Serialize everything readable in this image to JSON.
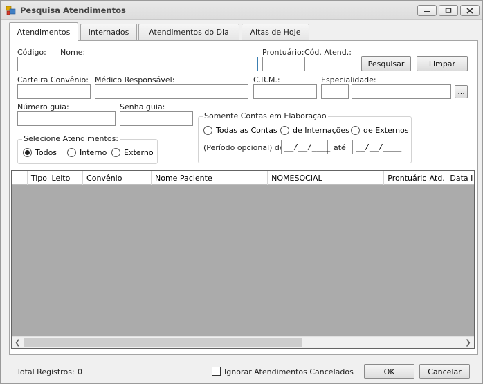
{
  "window": {
    "title": "Pesquisa Atendimentos"
  },
  "tabs": [
    {
      "label": "Atendimentos"
    },
    {
      "label": "Internados"
    },
    {
      "label": "Atendimentos do Dia"
    },
    {
      "label": "Altas de Hoje"
    }
  ],
  "form": {
    "codigo_label": "Código:",
    "nome_label": "Nome:",
    "prontuario_label": "Prontuário:",
    "cod_atend_label": "Cód. Atend.:",
    "pesquisar_label": "Pesquisar",
    "limpar_label": "Limpar",
    "carteira_label": "Carteira Convênio:",
    "medico_label": "Médico Responsável:",
    "crm_label": "C.R.M.:",
    "especialidade_label": "Especialidade:",
    "especialidade_button": "...",
    "numero_guia_label": "Número guia:",
    "senha_guia_label": "Senha guia:",
    "codigo_value": "",
    "nome_value": "",
    "prontuario_value": "",
    "cod_atend_value": "",
    "carteira_value": "",
    "medico_value": "",
    "crm_value": "",
    "esp_code_value": "",
    "esp_name_value": "",
    "numero_guia_value": "",
    "senha_guia_value": ""
  },
  "selecione": {
    "title": "Selecione Atendimentos:",
    "options": [
      {
        "label": "Todos"
      },
      {
        "label": "Interno"
      },
      {
        "label": "Externo"
      }
    ],
    "selected": "Todos"
  },
  "contas": {
    "title": "Somente Contas em Elaboração",
    "options": [
      {
        "label": "Todas as Contas"
      },
      {
        "label": "de Internações"
      },
      {
        "label": "de Externos"
      }
    ],
    "periodo_label": "(Período opcional) de",
    "ate_label": "até",
    "date_from": "__/__/____",
    "date_to": "__/__/____"
  },
  "grid": {
    "columns": [
      "",
      "Tipo",
      "Leito",
      "Convênio",
      "Nome Paciente",
      "NOMESOCIAL",
      "Prontuário",
      "Atd.",
      "Data I"
    ],
    "rows": []
  },
  "footer": {
    "total_label": "Total Registros:",
    "total_value": "0",
    "ignorar_label": "Ignorar Atendimentos Cancelados",
    "ok_label": "OK",
    "cancelar_label": "Cancelar"
  }
}
